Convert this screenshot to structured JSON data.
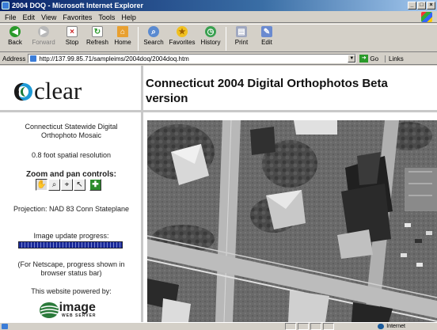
{
  "window": {
    "title": "2004 DOQ - Microsoft Internet Explorer",
    "controls": [
      "_",
      "□",
      "×"
    ]
  },
  "menu": [
    "File",
    "Edit",
    "View",
    "Favorites",
    "Tools",
    "Help"
  ],
  "toolbar": {
    "back": "Back",
    "forward": "Forward",
    "stop": "Stop",
    "refresh": "Refresh",
    "home": "Home",
    "search": "Search",
    "favorites": "Favorites",
    "history": "History",
    "print": "Print",
    "edit": "Edit"
  },
  "address": {
    "label": "Address",
    "url": "http://137.99.85.71/sampleims/2004doq/2004doq.htm",
    "go": "Go",
    "links": "Links"
  },
  "page": {
    "logo_text": "clear",
    "title": "Connecticut 2004 Digital Orthophotos Beta version",
    "mosaic": "Connecticut Statewide Digital Orthophoto Mosaic",
    "resolution": "0.8 foot spatial resolution",
    "zoom_title": "Zoom and pan controls:",
    "projection": "Projection: NAD 83 Conn Stateplane",
    "progress_label": "Image update progress:",
    "progress_value": 1.0,
    "netscape_note": "(For Netscape, progress shown in browser status bar)",
    "powered_by": "This website powered by:",
    "powered_logo": "image",
    "powered_logo_sub": "WEB SERVER"
  },
  "tools": [
    {
      "name": "pan-tool",
      "glyph": "✋"
    },
    {
      "name": "zoom-in-tool",
      "glyph": "🔍"
    },
    {
      "name": "zoom-out-tool",
      "glyph": "🔎"
    },
    {
      "name": "select-tool",
      "glyph": "↖"
    },
    {
      "name": "full-extent-tool",
      "glyph": "✚"
    }
  ],
  "status": {
    "zone": "Internet"
  },
  "colors": {
    "titlebar": "#0a246a",
    "progress": "#1a2a9a",
    "logo_blue": "#1e9ad6"
  }
}
